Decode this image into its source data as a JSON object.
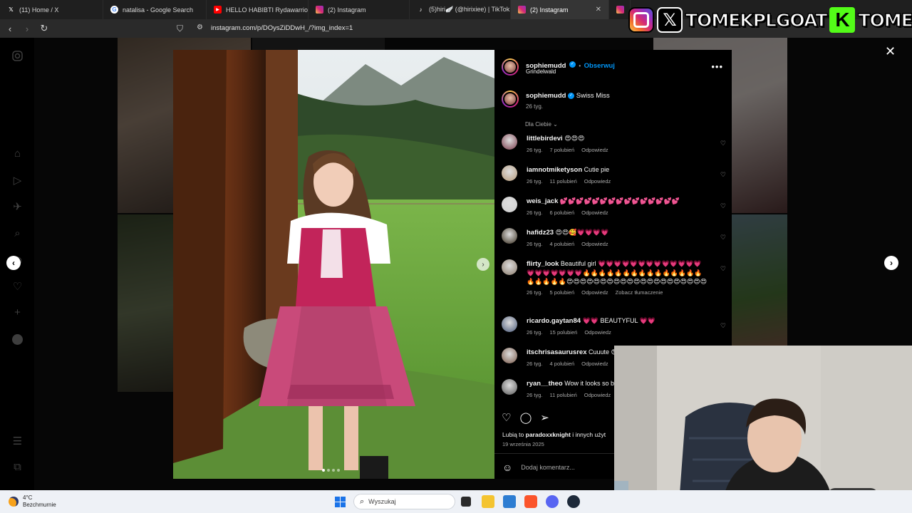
{
  "browser": {
    "tabs": [
      {
        "label": "(11) Home / X",
        "icon": "x-logo-icon"
      },
      {
        "label": "natalisa - Google Search",
        "icon": "google-icon"
      },
      {
        "label": "HELLO HABIBTI Rydawarrior [O",
        "icon": "youtube-icon"
      },
      {
        "label": "(2) Instagram",
        "icon": "instagram-icon"
      },
      {
        "label": "(5)hiri🪽 (@hirixiee) | TikTok",
        "icon": "tiktok-icon"
      },
      {
        "label": "(2) Instagram",
        "icon": "instagram-icon",
        "active": true
      }
    ],
    "url": "instagram.com/p/DOysZiDDwH_/?img_index=1"
  },
  "overlay": {
    "text1": "TOMEKPLGOAT",
    "text2": "TOMEKPL",
    "kick_letter": "K",
    "x_letter": "𝕏"
  },
  "post": {
    "author": "sophiemudd",
    "follow_label": "Obserwuj",
    "separator": "•",
    "location": "Grindelwald",
    "caption_user": "sophiemudd",
    "caption": "Swiss Miss",
    "caption_age": "26 tyg.",
    "filter_label": "Dla Ciebie",
    "likes_text": "Lubią to ",
    "likes_user": "paradoxxknight",
    "likes_rest": " i innych użyt",
    "date": "19 września 2025",
    "add_comment_placeholder": "Dodaj komentarz...",
    "reply_label": "Odpowiedz"
  },
  "comments": [
    {
      "user": "littlebirdevi",
      "text": "😍😍😍",
      "age": "26 tyg.",
      "likes": "7 polubień",
      "avatar": "#7a3a4a"
    },
    {
      "user": "iamnotmiketyson",
      "text": "Cutie pie",
      "age": "26 tyg.",
      "likes": "11 polubień",
      "avatar": "#b59a7a"
    },
    {
      "user": "weis_jack",
      "text": "💕💕💕💕💕💕💕💕💕💕💕💕💕💕💕",
      "age": "26 tyg.",
      "likes": "6 polubień",
      "avatar": "#cfcfcf"
    },
    {
      "user": "hafidz23",
      "text": "😍😍🥰💗💗💗💗",
      "age": "26 tyg.",
      "likes": "4 polubień",
      "avatar": "#3a3020"
    },
    {
      "user": "flirty_look",
      "text": "Beautiful girl 💗💗💗💗💗💗💗💗💗💗💗💗💗💗💗💗💗💗💗💗🔥🔥🔥🔥🔥🔥🔥🔥🔥🔥🔥🔥🔥🔥🔥🔥🔥🔥🔥🔥😍😍😍😍😍😍😍😍😍😍😍😍😍😍😍😍😍😍😍😍😍",
      "age": "26 tyg.",
      "likes": "5 polubień",
      "extra": "Zobacz tłumaczenie",
      "avatar": "#8a7a6a"
    },
    {
      "user": "ricardo.gaytan84",
      "text": "💗💗 BEAUTYFUL 💗💗",
      "age": "26 tyg.",
      "likes": "15 polubień",
      "avatar": "#4a5a7a"
    },
    {
      "user": "itschrisasaurusrex",
      "text": "Cuuute 😍",
      "age": "26 tyg.",
      "likes": "4 polubień",
      "avatar": "#7a5a4a"
    },
    {
      "user": "ryan__theo",
      "text": "Wow it looks so be",
      "age": "26 tyg.",
      "likes": "11 polubień",
      "avatar": "#5a5a5a"
    }
  ],
  "taskbar": {
    "temp": "4°C",
    "weather": "Bezchmurnie",
    "search_placeholder": "Wyszukaj"
  },
  "colors": {
    "accent": "#0095f6",
    "kick": "#53fc18",
    "dress": "#c2245a"
  }
}
